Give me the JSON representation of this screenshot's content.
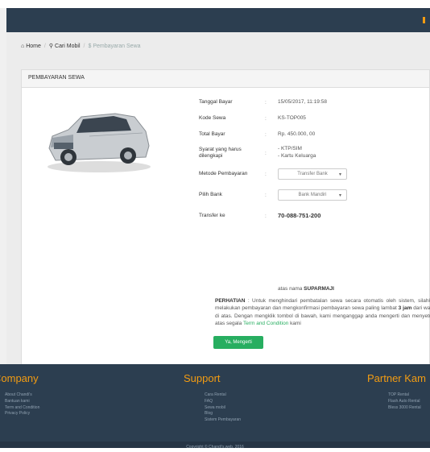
{
  "breadcrumb": {
    "home": "Home",
    "cari": "Cari Mobil",
    "current": "Pembayaran Sewa"
  },
  "panel": {
    "title": "PEMBAYARAN SEWA"
  },
  "details": {
    "tanggal_label": "Tanggal Bayar",
    "tanggal_value": "15/05/2017, 11:19:58",
    "kode_label": "Kode Sewa",
    "kode_value": "KS-TOP005",
    "total_label": "Total Bayar",
    "total_value": "Rp. 450.000, 00",
    "syarat_label": "Syarat yang harus dilengkapi",
    "syarat_value_1": "- KTP/SIM",
    "syarat_value_2": "- Kartu Keluarga",
    "metode_label": "Metode Pembayaran",
    "metode_value": "Transfer Bank",
    "bank_label": "Pilih Bank",
    "bank_value": "Bank Mandiri",
    "transfer_label": "Transfer ke",
    "transfer_value": "70-088-751-200",
    "atas_prefix": "atas nama",
    "atas_name": "SUPARMAJI"
  },
  "notice": {
    "title": "PERHATIAN",
    "text_1": ": Untuk menghindari pembatalan sewa secara otomatis oleh sistem, silahkan melakukan pembayaran dan mengkonfirmasi pembayaran sewa paling lambat",
    "deadline": "3 jam",
    "text_2": "dari waktu di atas. Dengan mengklik tombol di bawah, kami menganggap anda mengerti dan menyetujui atas segala",
    "link": "Term and Condition",
    "text_3": "kami"
  },
  "button": {
    "ok_label": "Ya, Mengerti"
  },
  "footer": {
    "company_title": "Company",
    "company_items": [
      "About Chandi's",
      "Bantuan kami",
      "Term and Condition",
      "Privacy Policy"
    ],
    "support_title": "Support",
    "support_items": [
      "Cara Rental",
      "FAQ",
      "Sewa mobil",
      "Blog",
      "Sistem Pembayaran"
    ],
    "partner_title": "Partner Kam",
    "partner_items": [
      "TOP Rental",
      "Flash Auto Rental",
      "Bless 3000 Rental"
    ],
    "copyright": "Copyright © Chandi's.web, 2016"
  },
  "colors": {
    "navbar": "#2c3e50",
    "accent": "#f39c12",
    "button": "#27ae60"
  }
}
